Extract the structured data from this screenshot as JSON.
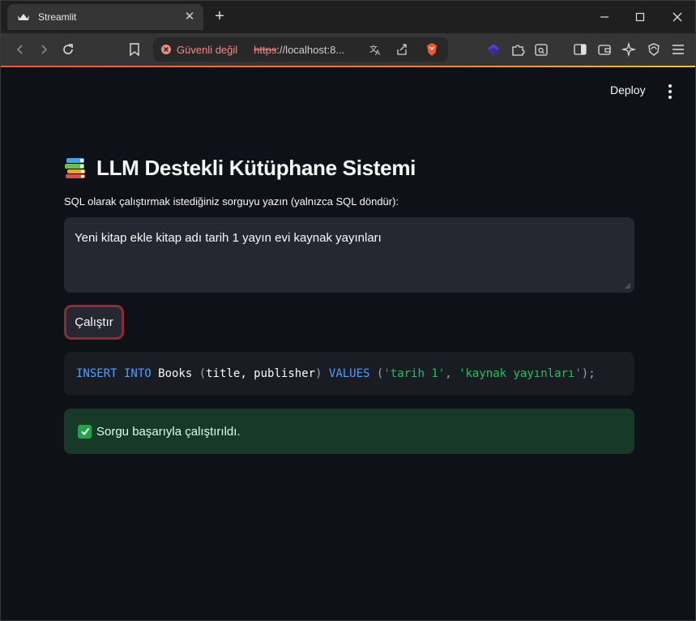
{
  "browser": {
    "tab_title": "Streamlit",
    "new_tab_symbol": "+",
    "tab_close_symbol": "✕",
    "security_label": "Güvenli değil",
    "url_protocol": "https",
    "url_rest": "://localhost:8...",
    "icons": [
      "streamlit-logo-icon",
      "back-icon",
      "forward-icon",
      "reload-icon",
      "bookmark-icon",
      "translate-icon",
      "share-icon",
      "brave-shield-icon",
      "extension-icon",
      "puzzle-icon",
      "search-page-icon",
      "sidebar-icon",
      "wallet-icon",
      "leo-ai-icon",
      "vpn-icon",
      "menu-icon",
      "minimize-icon",
      "maximize-icon",
      "close-icon"
    ],
    "accent_color": "#e8823a"
  },
  "header": {
    "deploy_label": "Deploy"
  },
  "main": {
    "title": "LLM Destekli Kütüphane Sistemi",
    "input_label": "SQL olarak çalıştırmak istediğiniz sorguyu yazın (yalnızca SQL döndür):",
    "input_value": "Yeni kitap ekle kitap adı tarih 1 yayın evi kaynak yayınları",
    "run_button_label": "Çalıştır",
    "code": {
      "kw1": "INSERT INTO",
      "table": " Books ",
      "open_paren": "(",
      "columns": "title, publisher",
      "close_paren": ") ",
      "kw2": "VALUES",
      "space": " ",
      "open_paren2": "(",
      "val1": "'tarih 1'",
      "comma": ", ",
      "val2": "'kaynak yayınları'",
      "end": ");"
    },
    "success_message": "Sorgu başarıyla çalıştırıldı.",
    "colors": {
      "background": "#0e1117",
      "primary_border": "#8b2c34",
      "success_bg": "#173928",
      "keyword": "#4b9fff",
      "string": "#21c354"
    }
  }
}
